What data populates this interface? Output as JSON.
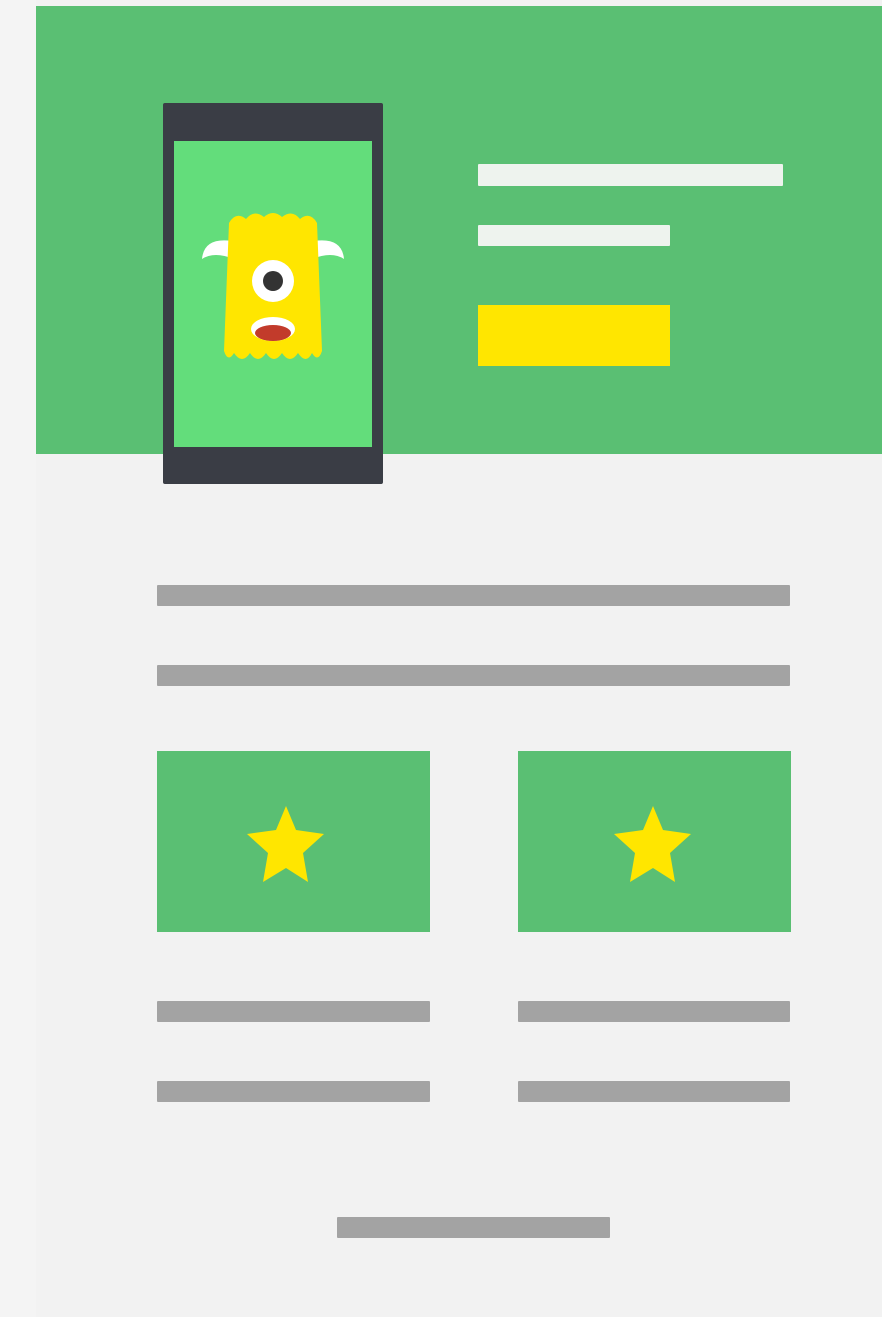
{
  "hero": {
    "cta_label": "",
    "background_color": "#5abf73",
    "phone_frame_color": "#3a3d45",
    "phone_screen_color": "#63dd7b",
    "mascot": {
      "icon": "one-eyed-monster-icon",
      "body_color": "#ffe600",
      "horn_color": "#ffffff",
      "eye_color": "#333333",
      "mouth_color": "#c23b2b"
    },
    "cta_color": "#ffe600"
  },
  "features": [
    {
      "icon": "star-icon",
      "icon_color": "#ffe600"
    },
    {
      "icon": "star-icon",
      "icon_color": "#ffe600"
    }
  ],
  "placeholder_line_color": "#a3a3a3",
  "page_background": "#f2f2f2"
}
